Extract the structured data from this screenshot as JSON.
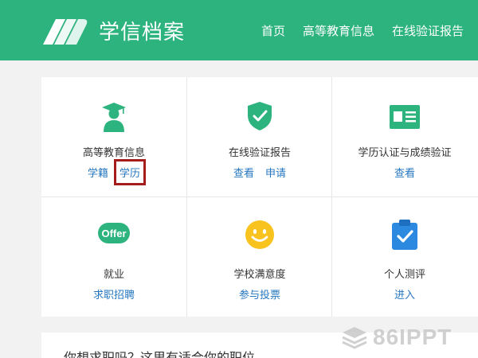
{
  "header": {
    "brand": "学信档案",
    "nav": [
      "首页",
      "高等教育信息",
      "在线验证报告"
    ],
    "colors": {
      "header_bg": "#2db37e",
      "link": "#2677c0",
      "highlight_border": "#a51c1c"
    }
  },
  "grid": {
    "cells": [
      {
        "title": "高等教育信息",
        "icon": "graduate-icon",
        "links": [
          "学籍",
          "学历"
        ]
      },
      {
        "title": "在线验证报告",
        "icon": "shield-check-icon",
        "links": [
          "查看",
          "申请"
        ]
      },
      {
        "title": "学历认证与成绩验证",
        "icon": "id-card-icon",
        "links": [
          "查看"
        ]
      },
      {
        "title": "就业",
        "icon": "offer-icon",
        "icon_text": "Offer",
        "links": [
          "求职招聘"
        ]
      },
      {
        "title": "学校满意度",
        "icon": "smiley-icon",
        "links": [
          "参与投票"
        ]
      },
      {
        "title": "个人测评",
        "icon": "clipboard-check-icon",
        "links": [
          "进入"
        ]
      }
    ]
  },
  "bottom": {
    "text": "你想求职吗？这里有适合你的职位"
  },
  "watermark": {
    "text": "86IPPT"
  }
}
